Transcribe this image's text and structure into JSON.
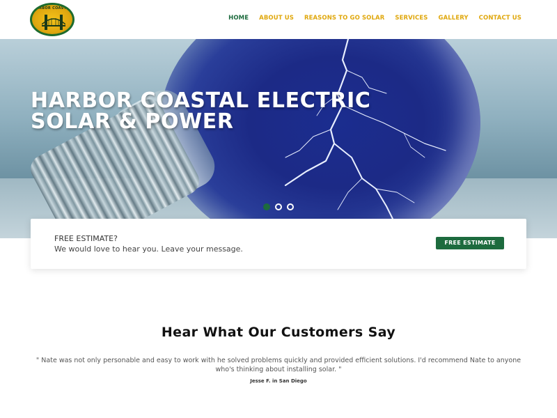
{
  "logo": {
    "text": "HARBOR COASTAL",
    "icon": "bridge-icon"
  },
  "nav": {
    "items": [
      "HOME",
      "ABOUT US",
      "REASONS TO GO SOLAR",
      "SERVICES",
      "GALLERY",
      "CONTACT US"
    ],
    "active_index": 0
  },
  "hero": {
    "title_line1": "HARBOR COASTAL ELECTRIC",
    "title_line2": "SOLAR & POWER",
    "slide_count": 3,
    "active_slide": 0
  },
  "estimate": {
    "title": "FREE ESTIMATE?",
    "subtitle": "We would love to hear you. Leave your message.",
    "button_label": "FREE ESTIMATE"
  },
  "testimonials": {
    "heading": "Hear What Our Customers Say",
    "quote": "\" Nate was not only personable and easy to work with he solved problems quickly and provided efficient solutions. I'd recommend Nate to anyone who's thinking about installing solar. \"",
    "author": "Jesse F. in San Diego"
  },
  "colors": {
    "accent_green": "#1d6b3e",
    "nav_gold": "#e0a80e"
  }
}
